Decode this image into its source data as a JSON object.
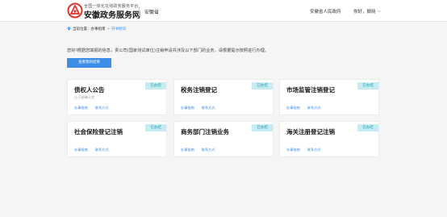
{
  "header": {
    "site_sub": "全国一体化在线政务服务平台",
    "site_name": "安徽政务服务网",
    "province": "安徽省",
    "gov_link": "安徽省人民政府",
    "user_greeting": "你好，鼓晓",
    "chevron": "⌵"
  },
  "breadcrumb": {
    "current_label": "当前位置：",
    "items": [
      "办事指南",
      "开书状况"
    ],
    "separator": ">"
  },
  "hint": "您好!根据您填报的信息，贵公司(国家测试单位)注销申请共涉及以下部门的业务，请根据提示按照进行办理。",
  "primary_button": "查看我的结果",
  "cards": [
    {
      "title": "债权人公告",
      "badge": "已办结",
      "status": "已经确认完",
      "links": [
        "办事指南",
        "联系方式"
      ]
    },
    {
      "title": "税务注销登记",
      "badge": "已办结",
      "links": [
        "办事指南",
        "联系方式"
      ]
    },
    {
      "title": "市场监管注销登记",
      "badge": "已办结",
      "links": [
        "办事指南",
        "联系方式"
      ]
    },
    {
      "title": "社会保险登记注销",
      "badge": "已办结",
      "links": [
        "办事指南",
        "联系方式"
      ]
    },
    {
      "title": "商务部门注销业务",
      "badge": "已办结",
      "links": [
        "办事指南",
        "联系方式"
      ]
    },
    {
      "title": "海关注册登记注销",
      "badge": "已办结",
      "links": [
        "办事指南",
        "联系方式"
      ]
    }
  ],
  "colors": {
    "primary": "#3d8ee6",
    "badge_bg": "#c4ecf2",
    "badge_text": "#2a9bb0",
    "logo_red": "#e0312a"
  }
}
